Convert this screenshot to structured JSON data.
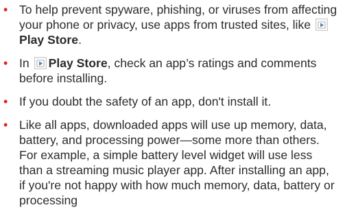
{
  "colors": {
    "bullet": "#e2231a",
    "text": "#2b2b2b"
  },
  "bullet_char": "•",
  "icons": {
    "play_store": "play-store-icon"
  },
  "items": [
    {
      "t1": "To help prevent spyware, phishing, or viruses from affecting your phone or privacy, use apps from trusted sites, like",
      "play_store": "Play Store",
      "t2": "."
    },
    {
      "t1": "In",
      "play_store": "Play Store",
      "t2": ", check an app’s ratings and comments before installing."
    },
    {
      "t1": "If you doubt the safety of an app, don't install it."
    },
    {
      "t1": "Like all apps, downloaded apps will use up memory, data, battery, and processing power—some more than others. For example, a simple battery level widget will use less than a streaming music player app. After installing an app, if you're not happy with how much memory, data, battery or processing"
    }
  ]
}
